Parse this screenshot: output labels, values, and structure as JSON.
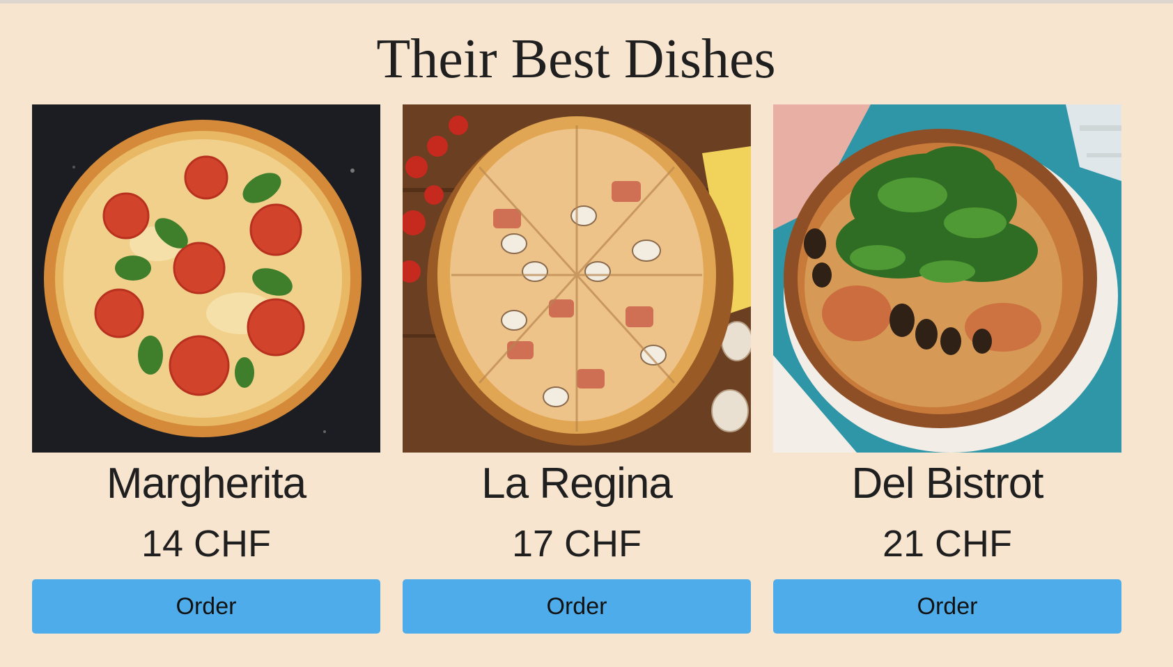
{
  "section": {
    "title": "Their Best Dishes"
  },
  "dishes": [
    {
      "name": "Margherita",
      "price": "14 CHF",
      "order_label": "Order",
      "image_icon": "pizza-margherita-photo"
    },
    {
      "name": "La Regina",
      "price": "17 CHF",
      "order_label": "Order",
      "image_icon": "pizza-regina-photo"
    },
    {
      "name": "Del Bistrot",
      "price": "21 CHF",
      "order_label": "Order",
      "image_icon": "pizza-bistrot-photo"
    }
  ],
  "colors": {
    "background": "#f8e5cf",
    "button": "#4eacea",
    "text": "#1f1f1f"
  }
}
